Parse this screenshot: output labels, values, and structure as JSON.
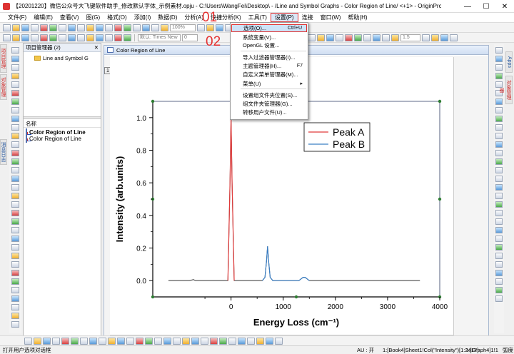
{
  "window": {
    "title": "【20201220】微信公众号大飞键软件助手_修改默认字体_示例素材.opju - C:\\Users\\WangFei\\Desktop\\ - /Line and Symbol Graphs - Color Region of Line/ <+1> - OriginPro 2019b 32-bit (Adm...",
    "min_label": "—",
    "max_label": "☐",
    "close_label": "✕"
  },
  "menubar": {
    "items": [
      "文件(F)",
      "编辑(E)",
      "查看(V)",
      "图(G)",
      "格式(O)",
      "添加(I)",
      "数据(D)",
      "分析(A)",
      "快捷分析(K)",
      "工具(T)",
      "设置(P)",
      "连接",
      "窗口(W)",
      "帮助(H)"
    ],
    "active_index": 10
  },
  "toolbar": {
    "zoom": "100%",
    "font_name": "默认: Times New",
    "font_size": "0",
    "line_width": "1.5"
  },
  "project_explorer": {
    "title": "项目管理器 (2)",
    "pin": "▾",
    "close": "✕",
    "folder": "Line and Symbol G",
    "list_header": "名称",
    "items": [
      "Color Region of Line",
      "Color Region of Line"
    ]
  },
  "graph_window": {
    "title": "Color Region of Line",
    "layer_label": "1"
  },
  "dropdown": {
    "items": [
      {
        "label": "选项(O)...",
        "shortcut": "Ctrl+U"
      },
      {
        "label": "系统变量(V)...",
        "shortcut": ""
      },
      {
        "label": "OpenGL 设置...",
        "shortcut": ""
      },
      {
        "label": "导入过滤器管理器(I)...",
        "shortcut": ""
      },
      {
        "label": "主题管理器(H)...",
        "shortcut": "F7"
      },
      {
        "label": "自定义菜单管理器(M)...",
        "shortcut": ""
      },
      {
        "label": "菜单(U)",
        "shortcut": "▸"
      },
      {
        "label": "设置组文件夹位置(S)...",
        "shortcut": ""
      },
      {
        "label": "组文件夹管理器(G)...",
        "shortcut": ""
      },
      {
        "label": "转移用户文件(U)...",
        "shortcut": ""
      }
    ]
  },
  "annotations": {
    "step1": "01",
    "step2": "02"
  },
  "side_tabs": {
    "left": [
      "项目管理器",
      "对象管理器",
      "消息日志"
    ],
    "right": [
      "Apps",
      "对象管理器"
    ]
  },
  "statusbar": {
    "message": "打开用户选项对话框",
    "au": "AU : 开",
    "book": "1:[Book4]Sheet1!Col(\"Intensity\")[1:2417]",
    "graph": "1:[Graph4]1!1",
    "unit": "弧度"
  },
  "colors": {
    "peak_a": "#e03a3a",
    "peak_b": "#3b7fc4",
    "highlight_border": "#e03030",
    "menu_highlight": "#cde3f8"
  },
  "chart_data": {
    "type": "line",
    "title": "",
    "xlabel": "Energy Loss (cm⁻¹)",
    "ylabel": "Intensity (arb.units)",
    "xlim": [
      -1500,
      4000
    ],
    "ylim": [
      -0.1,
      1.1
    ],
    "x_ticks": [
      0,
      1000,
      2000,
      3000,
      4000
    ],
    "x_tick_labels": [
      "0",
      "1000",
      "2000",
      "3000",
      "4000"
    ],
    "y_ticks": [
      0.0,
      0.2,
      0.4,
      0.6,
      0.8,
      1.0
    ],
    "y_tick_labels": [
      "0.0",
      "0.2",
      "0.4",
      "0.6",
      "0.8",
      "1.0"
    ],
    "grid": false,
    "legend_position": "top-right",
    "series": [
      {
        "name": "Peak A",
        "color": "#e03a3a",
        "x": [
          -1200,
          -800,
          -720,
          -680,
          -600,
          -300,
          -60,
          -20,
          0,
          20,
          60,
          300,
          600
        ],
        "y": [
          0.0,
          0.0,
          0.006,
          0.0,
          0.0,
          0.0,
          0.0,
          0.6,
          1.0,
          0.6,
          0.0,
          0.0,
          0.0
        ]
      },
      {
        "name": "Peak B",
        "color": "#3b7fc4",
        "x": [
          600,
          650,
          680,
          700,
          720,
          750,
          800,
          1300,
          1380,
          1420,
          1500,
          2000,
          3000,
          3620
        ],
        "y": [
          0.0,
          0.02,
          0.12,
          0.21,
          0.12,
          0.02,
          0.0,
          0.0,
          0.02,
          0.02,
          0.0,
          0.0,
          0.0,
          0.0
        ]
      }
    ]
  }
}
